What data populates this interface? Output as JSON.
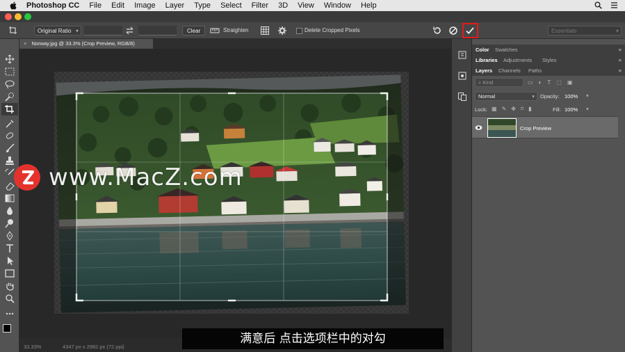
{
  "menubar": {
    "app_name": "Photoshop CC",
    "items": [
      "File",
      "Edit",
      "Image",
      "Layer",
      "Type",
      "Select",
      "Filter",
      "3D",
      "View",
      "Window",
      "Help"
    ]
  },
  "options": {
    "ratio": "Original Ratio",
    "clear": "Clear",
    "straighten": "Straighten",
    "delete_cropped": "Delete Cropped Pixels",
    "workspace": "Essentials"
  },
  "document": {
    "tab_title": "Norway.jpg @ 33.3% (Crop Preview, RGB/8)",
    "zoom": "33.33%",
    "dimensions": "4347 px x 2982 px (72 ppi)"
  },
  "panels": {
    "color_tabs": [
      "Color",
      "Swatches"
    ],
    "library_tabs": [
      "Libraries",
      "Adjustments",
      "Styles"
    ],
    "layer_tabs": [
      "Layers",
      "Channels",
      "Paths"
    ],
    "kind_placeholder": "Kind",
    "blend_mode": "Normal",
    "opacity_label": "Opacity:",
    "opacity_value": "100%",
    "lock_label": "Lock:",
    "fill_label": "Fill:",
    "fill_value": "100%",
    "layer_name": "Crop Preview"
  },
  "watermark": "www.MacZ.com",
  "subtitle": "满意后 点击选项栏中的对勾",
  "colors": {
    "accent_highlight": "#e61919",
    "panel_bg": "#535353",
    "canvas_bg": "#282828"
  }
}
